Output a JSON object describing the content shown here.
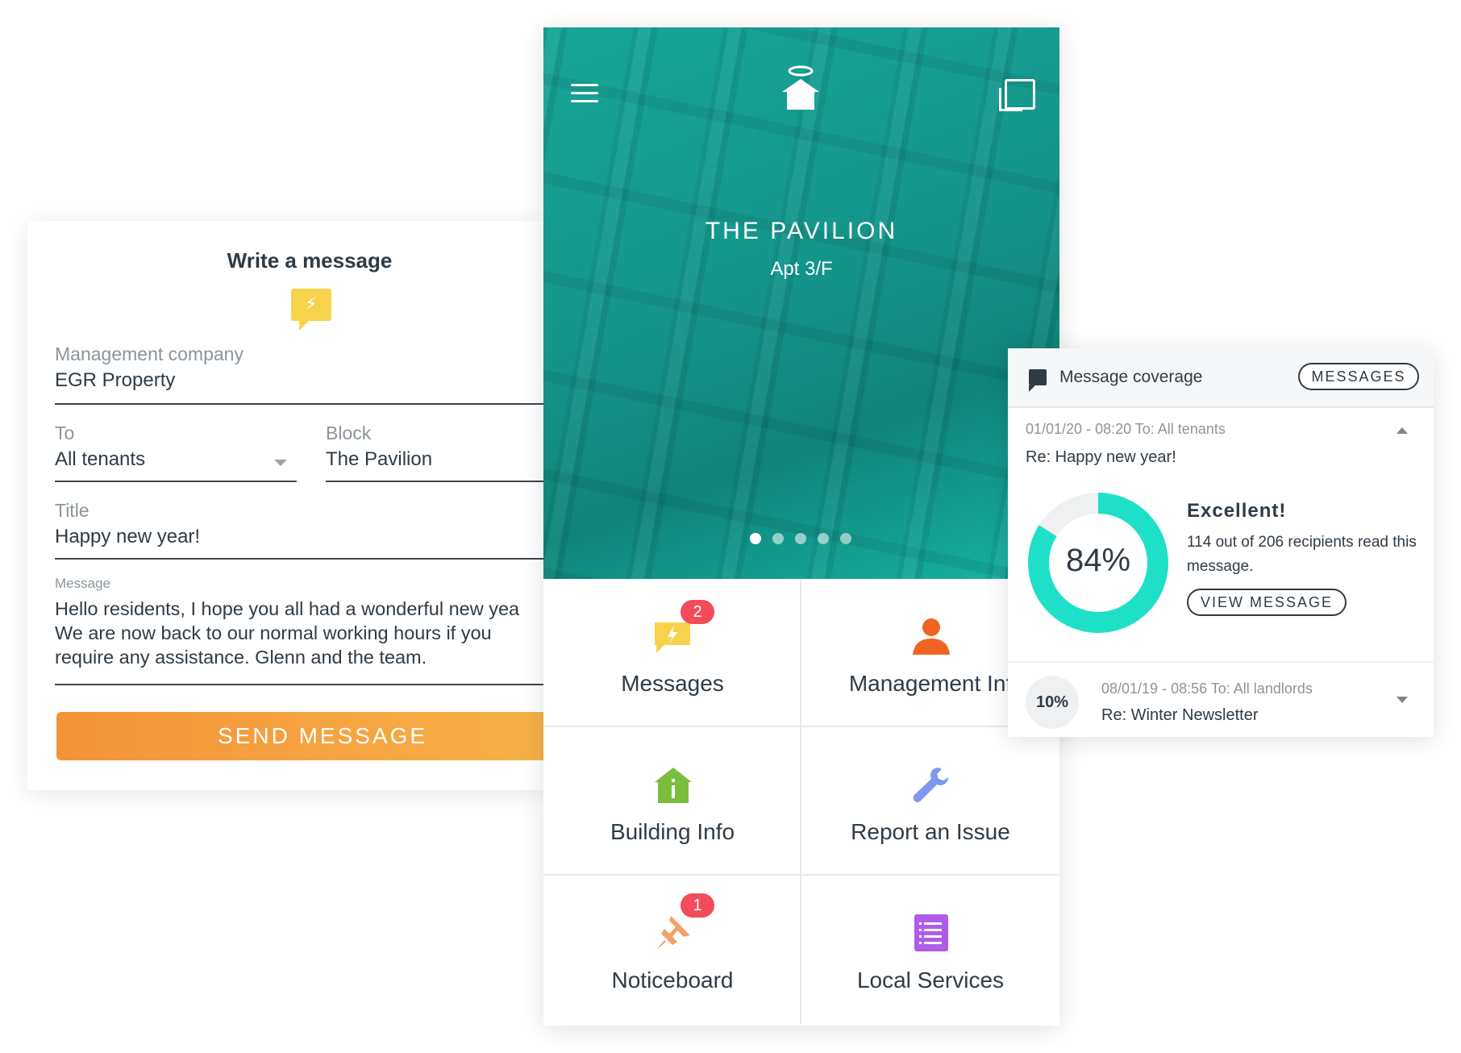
{
  "compose": {
    "title": "Write a message",
    "icon": "message-bolt-icon",
    "management_label": "Management company",
    "management_value": "EGR Property",
    "to_label": "To",
    "to_value": "All tenants",
    "block_label": "Block",
    "block_value": "The Pavilion",
    "title_label": "Title",
    "title_value": "Happy new year!",
    "message_label": "Message",
    "message_lines": [
      "Hello residents, I hope you all had a wonderful new yea",
      "We are now back to our normal working hours if you",
      "require any assistance. Glenn and the team."
    ],
    "send_label": "SEND MESSAGE",
    "send_colors": [
      "#f39237",
      "#f7b44a"
    ]
  },
  "phone": {
    "building": "THE PAVILION",
    "apartment": "Apt 3/F",
    "slides": 5,
    "active_slide": 0,
    "tiles": [
      {
        "label": "Messages",
        "icon": "message-icon",
        "badge": "2",
        "color": "#f7d34d"
      },
      {
        "label": "Management Inf",
        "icon": "person-icon",
        "color": "#f06423"
      },
      {
        "label": "Building Info",
        "icon": "house-info-icon",
        "color": "#7bbd3c"
      },
      {
        "label": "Report an Issue",
        "icon": "wrench-icon",
        "color": "#7f98ef"
      },
      {
        "label": "Noticeboard",
        "icon": "pin-icon",
        "badge": "1",
        "color": "#f5a06a"
      },
      {
        "label": "Local Services",
        "icon": "list-icon",
        "color": "#b05ce8"
      }
    ],
    "accent": "#14a093"
  },
  "coverage": {
    "title": "Message coverage",
    "messages_button": "MESSAGES",
    "item1": {
      "meta": "01/01/20 - 08:20   To: All tenants",
      "subject": "Re: Happy new year!",
      "percent_label": "84%",
      "percent_value": 0.84,
      "rating": "Excellent!",
      "desc": "114 out of 206 recipients read this message.",
      "view_button": "VIEW MESSAGE",
      "ring_color": "#1ee0c8"
    },
    "item2": {
      "percent_label": "10%",
      "meta": "08/01/19 - 08:56   To: All landlords",
      "subject": "Re: Winter Newsletter"
    }
  }
}
